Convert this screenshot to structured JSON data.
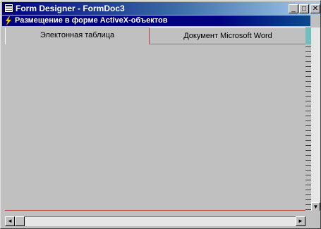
{
  "window": {
    "title": "Form Designer - FormDoc3",
    "controls": {
      "minimize": "_",
      "maximize": "□",
      "close": "✕"
    }
  },
  "subwindow": {
    "title": "Размещение в форме ActiveX-объектов"
  },
  "tabs": [
    {
      "label": "Электонная таблица"
    },
    {
      "label": "Документ Microsoft Word"
    }
  ],
  "scroll": {
    "left_arrow": "◄",
    "right_arrow": "►",
    "down_arrow": "▼"
  },
  "colors": {
    "title_start": "#000080",
    "title_end": "#a6caf0",
    "face": "#c0c0c0"
  }
}
